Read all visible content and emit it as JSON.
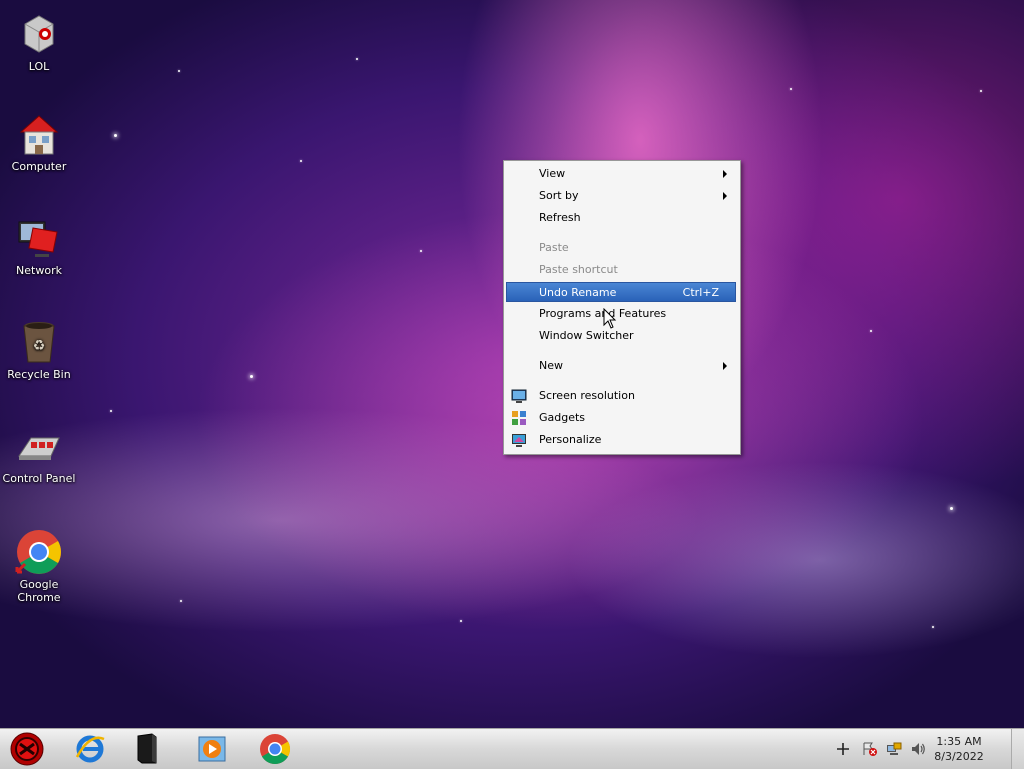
{
  "desktop_icons": [
    {
      "label": "LOL"
    },
    {
      "label": "Computer"
    },
    {
      "label": "Network"
    },
    {
      "label": "Recycle Bin"
    },
    {
      "label": "Control Panel"
    },
    {
      "label": "Google Chrome"
    }
  ],
  "context_menu": {
    "items": [
      {
        "label": "View",
        "submenu": true
      },
      {
        "label": "Sort by",
        "submenu": true
      },
      {
        "label": "Refresh"
      },
      {
        "label": "Paste",
        "disabled": true
      },
      {
        "label": "Paste shortcut",
        "disabled": true
      },
      {
        "label": "Undo Rename",
        "shortcut": "Ctrl+Z",
        "highlighted": true
      },
      {
        "label": "Programs and Features"
      },
      {
        "label": "Window Switcher"
      },
      {
        "label": "New",
        "submenu": true
      },
      {
        "label": "Screen resolution",
        "icon": "screen-resolution-icon"
      },
      {
        "label": "Gadgets",
        "icon": "gadgets-icon"
      },
      {
        "label": "Personalize",
        "icon": "personalize-icon"
      }
    ]
  },
  "taskbar": {
    "start_icon": "start-orb-icon",
    "pinned": [
      "internet-explorer-icon",
      "file-explorer-icon",
      "media-player-icon",
      "chrome-icon"
    ],
    "tray": [
      "plus-icon",
      "action-center-icon",
      "network-icon",
      "volume-icon"
    ],
    "clock": {
      "time": "1:35 AM",
      "date": "8/3/2022"
    }
  },
  "colors": {
    "menu_highlight": "#3a74c6",
    "taskbar": "#d8d8d8"
  }
}
